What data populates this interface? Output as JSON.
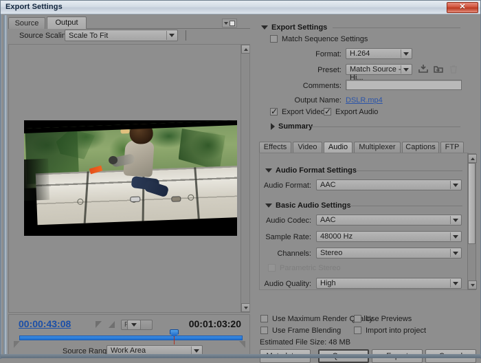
{
  "window": {
    "title": "Export Settings",
    "close_icon": "close-icon",
    "close_glyph": "✕"
  },
  "left_panel": {
    "tabs": [
      {
        "label": "Source",
        "active": false
      },
      {
        "label": "Output",
        "active": true
      }
    ],
    "panel_menu_icon": "panel-menu-icon",
    "source_scaling": {
      "label": "Source Scaling:",
      "value": "Scale To Fit"
    },
    "preview": {
      "scrollbar_up_icon": "scroll-up-icon",
      "scrollbar_down_icon": "scroll-down-icon"
    },
    "timeline": {
      "current_timecode": "00:00:43:08",
      "duration_timecode": "00:01:03:20",
      "mark_in_icon": "mark-in-icon",
      "mark_out_icon": "mark-out-icon",
      "zoom_level": "Fit",
      "source_range_label": "Source Range:",
      "source_range_value": "Work Area",
      "playhead_icon": "playhead-icon",
      "range_in_icon": "range-in-handle-icon",
      "range_out_icon": "range-out-handle-icon"
    }
  },
  "right_panel": {
    "export_settings": {
      "header": "Export Settings",
      "match_sequence_settings": {
        "label": "Match Sequence Settings",
        "checked": false
      },
      "format": {
        "label": "Format:",
        "value": "H.264"
      },
      "preset": {
        "label": "Preset:",
        "value": "Match Source - Hi..."
      },
      "preset_icons": {
        "save": "save-preset-icon",
        "import": "import-preset-icon",
        "delete": "delete-preset-icon"
      },
      "comments": {
        "label": "Comments:",
        "value": "",
        "placeholder": ""
      },
      "output_name": {
        "label": "Output Name:",
        "value": "DSLR.mp4"
      },
      "export_video": {
        "label": "Export Video",
        "checked": true
      },
      "export_audio": {
        "label": "Export Audio",
        "checked": true
      },
      "summary": {
        "header": "Summary",
        "expanded": false
      }
    },
    "tabs": [
      {
        "label": "Effects",
        "active": false
      },
      {
        "label": "Video",
        "active": false
      },
      {
        "label": "Audio",
        "active": true
      },
      {
        "label": "Multiplexer",
        "active": false
      },
      {
        "label": "Captions",
        "active": false
      },
      {
        "label": "FTP",
        "active": false
      }
    ],
    "audio_format_settings": {
      "header": "Audio Format Settings",
      "audio_format": {
        "label": "Audio Format:",
        "value": "AAC"
      }
    },
    "basic_audio_settings": {
      "header": "Basic Audio Settings",
      "audio_codec": {
        "label": "Audio Codec:",
        "value": "AAC"
      },
      "sample_rate": {
        "label": "Sample Rate:",
        "value": "48000 Hz"
      },
      "channels": {
        "label": "Channels:",
        "value": "Stereo"
      },
      "parametric_stereo": {
        "label": "Parametric Stereo",
        "checked": false,
        "disabled": true
      },
      "audio_quality": {
        "label": "Audio Quality:",
        "value": "High"
      }
    },
    "options": {
      "use_maximum_render_quality": {
        "label": "Use Maximum Render Quality",
        "checked": false
      },
      "use_previews": {
        "label": "Use Previews",
        "checked": false
      },
      "use_frame_blending": {
        "label": "Use Frame Blending",
        "checked": false
      },
      "import_into_project": {
        "label": "Import into project",
        "checked": false
      }
    },
    "estimated_file_size": "Estimated File Size:  48 MB",
    "buttons": {
      "metadata": "Metadata...",
      "queue": "Queue",
      "export": "Export",
      "cancel": "Cancel"
    }
  },
  "colors": {
    "panel_bg": "#8e8e8e",
    "titlebar": "#d3dce5",
    "link": "#2b54a8",
    "timecode_active": "#1b4fa8",
    "scrub_bar": "#2a78d6",
    "close_button": "#bb3a22"
  }
}
